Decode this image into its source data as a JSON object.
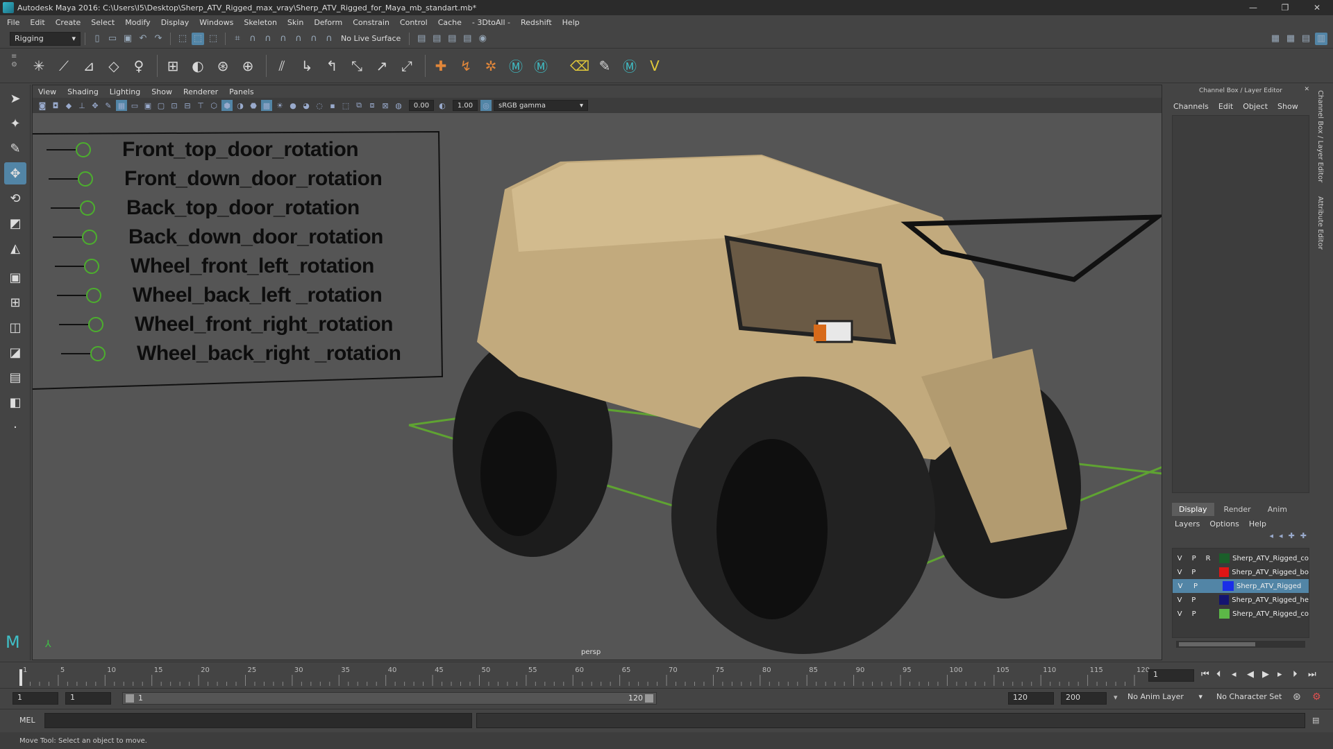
{
  "window": {
    "title": "Autodesk Maya 2016: C:\\Users\\I5\\Desktop\\Sherp_ATV_Rigged_max_vray\\Sherp_ATV_Rigged_for_Maya_mb_standart.mb*",
    "minimize": "—",
    "restore": "❐",
    "close": "✕"
  },
  "menubar": [
    "File",
    "Edit",
    "Create",
    "Select",
    "Modify",
    "Display",
    "Windows",
    "Skeleton",
    "Skin",
    "Deform",
    "Constrain",
    "Control",
    "Cache",
    "- 3DtoAll -",
    "Redshift",
    "Help"
  ],
  "statusline": {
    "mode": "Rigging",
    "live_surface": "No Live Surface"
  },
  "viewport": {
    "menu": [
      "View",
      "Shading",
      "Lighting",
      "Show",
      "Renderer",
      "Panels"
    ],
    "field1": "0.00",
    "field2": "1.00",
    "color_space": "sRGB gamma",
    "camera": "persp"
  },
  "controls": [
    "Front_top_door_rotation",
    "Front_down_door_rotation",
    "Back_top_door_rotation",
    "Back_down_door_rotation",
    "Wheel_front_left_rotation",
    "Wheel_back_left _rotation",
    "Wheel_front_right_rotation",
    "Wheel_back_right _rotation"
  ],
  "channel_box": {
    "header": "Channel Box / Layer Editor",
    "menu": [
      "Channels",
      "Edit",
      "Object",
      "Show"
    ]
  },
  "side_tabs": [
    "Channel Box / Layer Editor",
    "Attribute Editor"
  ],
  "layer_editor": {
    "tabs": [
      "Display",
      "Render",
      "Anim"
    ],
    "menu": [
      "Layers",
      "Options",
      "Help"
    ],
    "layers": [
      {
        "v": "V",
        "p": "P",
        "r": "R",
        "name": "Sherp_ATV_Rigged_co",
        "color": "#1b5e2a",
        "selected": false
      },
      {
        "v": "V",
        "p": "P",
        "r": "",
        "name": "Sherp_ATV_Rigged_bo",
        "color": "#e01515",
        "selected": false
      },
      {
        "v": "V",
        "p": "P",
        "r": "",
        "name": "Sherp_ATV_Rigged",
        "color": "#1a2ee8",
        "selected": true
      },
      {
        "v": "V",
        "p": "P",
        "r": "",
        "name": "Sherp_ATV_Rigged_he",
        "color": "#141470",
        "selected": false
      },
      {
        "v": "V",
        "p": "P",
        "r": "",
        "name": "Sherp_ATV_Rigged_co",
        "color": "#5cb847",
        "selected": false
      }
    ]
  },
  "timeline": {
    "ticks": [
      "1",
      "5",
      "10",
      "15",
      "20",
      "25",
      "30",
      "35",
      "40",
      "45",
      "50",
      "55",
      "60",
      "65",
      "70",
      "75",
      "80",
      "85",
      "90",
      "95",
      "100",
      "105",
      "110",
      "115",
      "120"
    ],
    "current_frame": "1"
  },
  "range": {
    "start": "1",
    "playback_start": "1",
    "slider_start": "1",
    "slider_end": "120",
    "playback_end": "120",
    "end": "200",
    "anim_layer": "No Anim Layer",
    "character_set": "No Character Set"
  },
  "cmdline": {
    "label": "MEL"
  },
  "helpline": "Move Tool: Select an object to move."
}
